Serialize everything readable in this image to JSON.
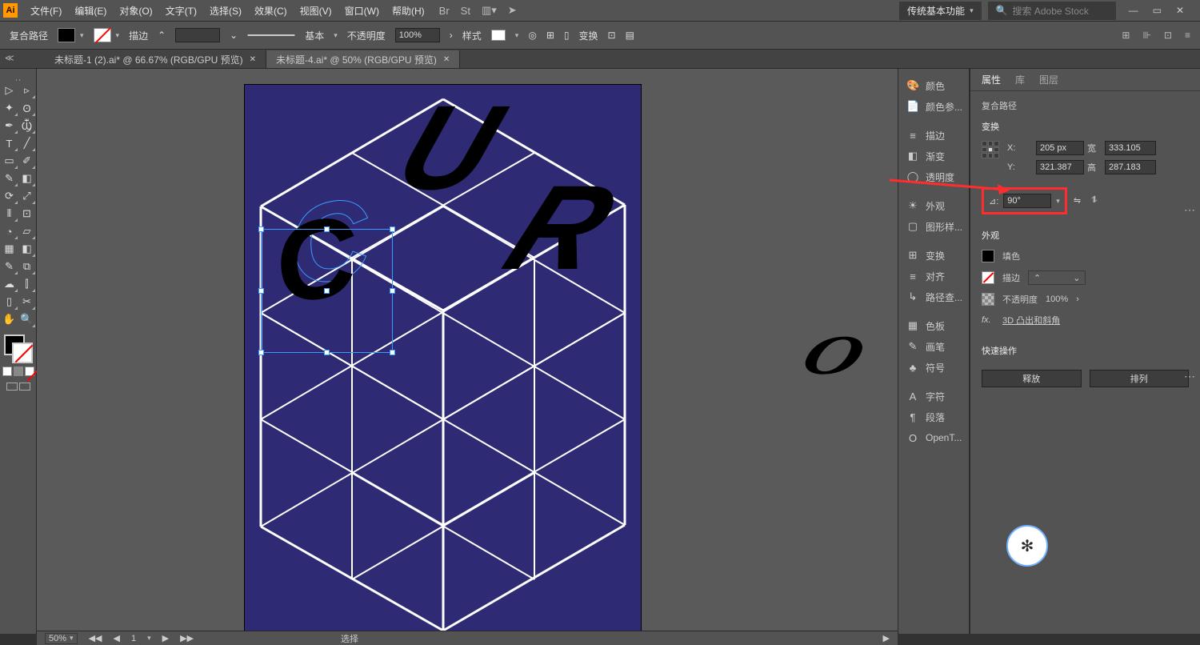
{
  "menu": {
    "items": [
      "文件(F)",
      "编辑(E)",
      "对象(O)",
      "文字(T)",
      "选择(S)",
      "效果(C)",
      "视图(V)",
      "窗口(W)",
      "帮助(H)"
    ],
    "workspace": "传统基本功能",
    "searchPlaceholder": "搜索 Adobe Stock"
  },
  "controlbar": {
    "mode": "复合路径",
    "strokeLabel": "描边",
    "styleLabel": "基本",
    "opacityLabel": "不透明度",
    "opacityValue": "100%",
    "presetLabel": "样式",
    "transformLabel": "变换"
  },
  "tabs": [
    {
      "title": "未标题-1 (2).ai* @ 66.67% (RGB/GPU 预览)",
      "active": false
    },
    {
      "title": "未标题-4.ai* @ 50% (RGB/GPU 预览)",
      "active": true
    }
  ],
  "status": {
    "zoom": "50%",
    "nav": "1",
    "mode": "选择"
  },
  "panelIcons": [
    {
      "icon": "🎨",
      "label": "颜色"
    },
    {
      "icon": "📄",
      "label": "颜色参..."
    },
    {
      "gap": true
    },
    {
      "icon": "≡",
      "label": "描边"
    },
    {
      "icon": "◧",
      "label": "渐变"
    },
    {
      "icon": "◯",
      "label": "透明度"
    },
    {
      "gap": true
    },
    {
      "icon": "☀",
      "label": "外观"
    },
    {
      "icon": "▢",
      "label": "图形样..."
    },
    {
      "gap": true
    },
    {
      "icon": "⊞",
      "label": "变换"
    },
    {
      "icon": "≡",
      "label": "对齐"
    },
    {
      "icon": "↳",
      "label": "路径查..."
    },
    {
      "gap": true
    },
    {
      "icon": "▦",
      "label": "色板"
    },
    {
      "icon": "✎",
      "label": "画笔"
    },
    {
      "icon": "♣",
      "label": "符号"
    },
    {
      "gap": true
    },
    {
      "icon": "A",
      "label": "字符"
    },
    {
      "icon": "¶",
      "label": "段落"
    },
    {
      "icon": "O",
      "label": "OpenT..."
    }
  ],
  "props": {
    "tabs": [
      "属性",
      "库",
      "图层"
    ],
    "objType": "复合路径",
    "transformTitle": "变换",
    "x": "205 px",
    "y": "321.387",
    "wLabel": "宽",
    "w": "333.105",
    "hLabel": "高",
    "h": "287.183",
    "rotLabel": "⊿:",
    "rot": "90°",
    "appearanceTitle": "外观",
    "fillLabel": "填色",
    "strokeLabel": "描边",
    "opLabel": "不透明度",
    "opVal": "100%",
    "fxLabel": "fx.",
    "fxVal": "3D 凸出和斜角",
    "quickTitle": "快速操作",
    "btn1": "释放",
    "btn2": "排列"
  }
}
